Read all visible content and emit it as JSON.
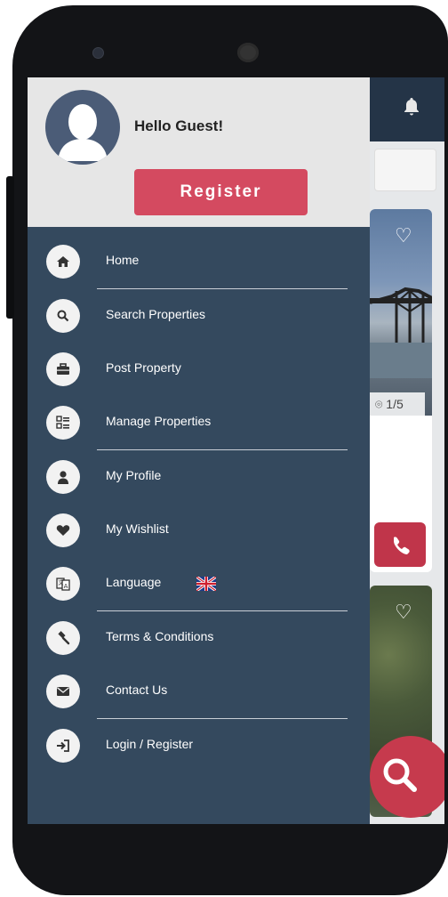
{
  "header": {
    "greeting": "Hello Guest!",
    "register_label": "Register"
  },
  "menu": {
    "items": [
      {
        "label": "Home",
        "icon": "home-icon"
      },
      {
        "label": "Search Properties",
        "icon": "search-icon"
      },
      {
        "label": "Post Property",
        "icon": "briefcase-icon"
      },
      {
        "label": "Manage Properties",
        "icon": "grid-list-icon"
      },
      {
        "label": "My Profile",
        "icon": "user-icon"
      },
      {
        "label": "My Wishlist",
        "icon": "heart-icon"
      },
      {
        "label": "Language",
        "icon": "translate-icon"
      },
      {
        "label": "Terms & Conditions",
        "icon": "gavel-icon"
      },
      {
        "label": "Contact Us",
        "icon": "envelope-icon"
      },
      {
        "label": "Login / Register",
        "icon": "sign-in-icon"
      }
    ]
  },
  "background": {
    "photo_counter": "1/5"
  },
  "colors": {
    "drawer_bg": "#34495e",
    "header_bg": "#e6e6e6",
    "accent": "#d44a60"
  }
}
